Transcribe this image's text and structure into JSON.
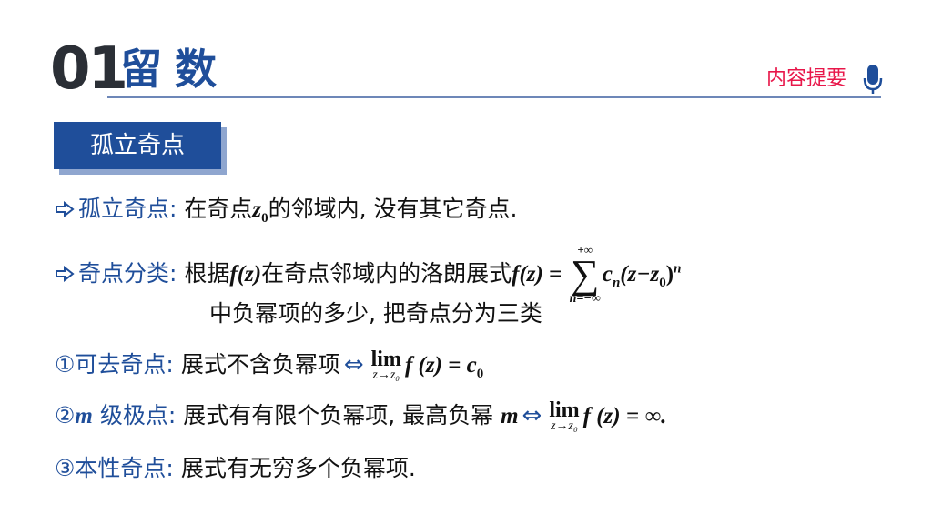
{
  "header": {
    "section_number": "01",
    "section_title": "留数",
    "summary_label": "内容提要"
  },
  "tag": {
    "label": "孤立奇点"
  },
  "items": {
    "isolated": {
      "term": "孤立奇点:",
      "text_a": "在奇点",
      "z": "z",
      "zero": "0",
      "text_b": "的邻域内, 没有其它奇点."
    },
    "classify": {
      "term": "奇点分类:",
      "text_a": "根据",
      "fz": "f(z)",
      "text_b": "在奇点邻域内的洛朗展式",
      "fz2": "f(z)",
      "eq": " = ",
      "sum_top": "+∞",
      "sum_sym": "∑",
      "sum_bot": "n=−∞",
      "c": "c",
      "n_sub": "n",
      "paren": "(z−z",
      "zero": "0",
      "close": ")",
      "n_sup": "n",
      "line2": "中负幂项的多少, 把奇点分为三类"
    },
    "removable": {
      "marker": "①",
      "term": "可去奇点:",
      "text": "展式不含负幂项",
      "iff": "⇔",
      "lim": "lim",
      "lim_sub": "z→z₀",
      "expr": "f (z) = c",
      "zero": "0"
    },
    "pole": {
      "marker": "②",
      "m": "m",
      "term": " 级极点:",
      "text": "展式有有限个负幂项, 最高负幂",
      "m2": "m",
      "iff": "⇔",
      "lim": "lim",
      "lim_sub": "z→z₀",
      "expr": "f (z) = ∞."
    },
    "essential": {
      "marker": "③",
      "term": "本性奇点:",
      "text": "展式有无穷多个负幂项."
    }
  },
  "colors": {
    "accent": "#1f4e9a",
    "summary": "#e8174a",
    "dark": "#2b2f36"
  }
}
